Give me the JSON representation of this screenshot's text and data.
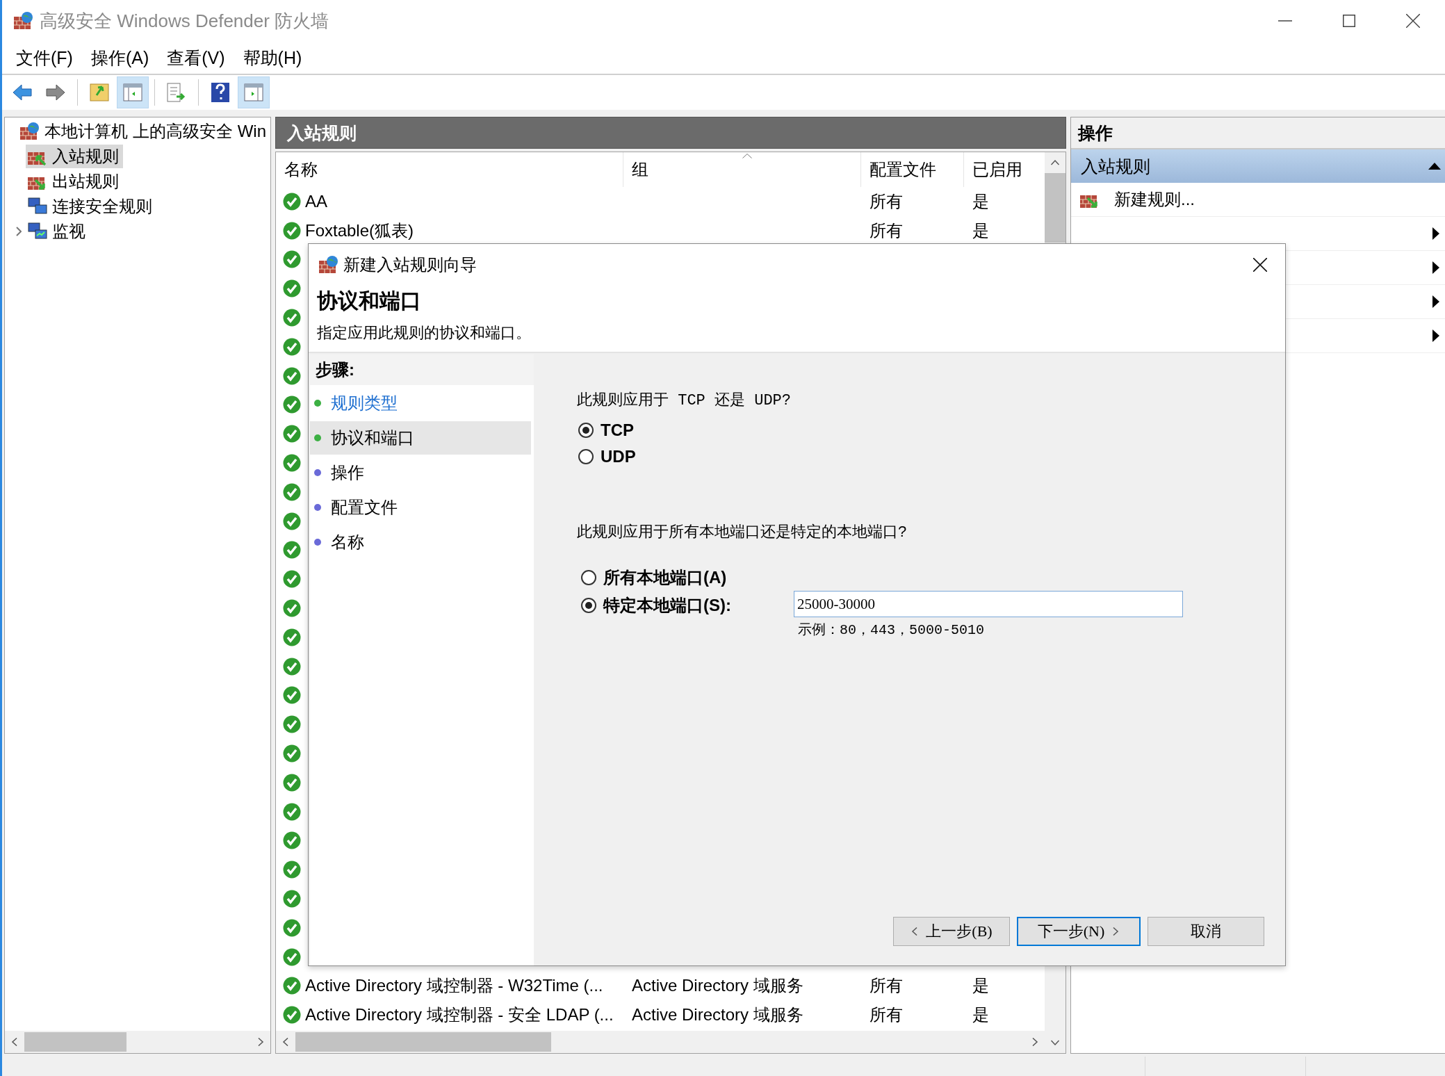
{
  "window": {
    "title": "高级安全 Windows Defender 防火墙"
  },
  "menu": [
    "文件(F)",
    "操作(A)",
    "查看(V)",
    "帮助(H)"
  ],
  "toolbar": [
    [
      {
        "kind": "back",
        "on": false
      },
      {
        "kind": "forward",
        "on": false
      }
    ],
    [
      {
        "kind": "up",
        "on": false
      },
      {
        "kind": "tree",
        "on": true
      }
    ],
    [
      {
        "kind": "export",
        "on": false
      }
    ],
    [
      {
        "kind": "help",
        "on": false
      },
      {
        "kind": "pane",
        "on": true
      }
    ]
  ],
  "tree": {
    "items": [
      {
        "label": "本地计算机 上的高级安全 Win",
        "kind": "root",
        "selected": false,
        "children": [
          {
            "label": "入站规则",
            "kind": "inbound",
            "selected": true
          },
          {
            "label": "出站规则",
            "kind": "outbound",
            "selected": false
          },
          {
            "label": "连接安全规则",
            "kind": "connection",
            "selected": false
          },
          {
            "label": "监视",
            "kind": "monitor",
            "selected": false,
            "expanded": false
          }
        ]
      }
    ]
  },
  "rules": {
    "title": "入站规则",
    "columns": [
      {
        "label": "名称",
        "sorted": false
      },
      {
        "label": "组",
        "sorted": true
      },
      {
        "label": "配置文件",
        "sorted": false
      },
      {
        "label": "已启用",
        "sorted": false
      }
    ],
    "top_rows": [
      {
        "name": "AA",
        "profile": "所有",
        "enabled": "是"
      },
      {
        "name": "Foxtable(狐表)",
        "profile": "所有",
        "enabled": "是"
      }
    ],
    "bottom_rows": [
      {
        "name": "Active Directory 域控制器 - W32Time (...",
        "group": "Active Directory 域服务",
        "profile": "所有",
        "enabled": "是"
      },
      {
        "name": "Active Directory 域控制器 - 安全 LDAP (...",
        "group": "Active Directory 域服务",
        "profile": "所有",
        "enabled": "是"
      }
    ]
  },
  "actions": {
    "title": "操作",
    "section": {
      "label": "入站规则",
      "expanded": true
    },
    "items": [
      {
        "kind": "command",
        "label": "新建规则..."
      },
      {
        "kind": "submenu"
      },
      {
        "kind": "submenu"
      },
      {
        "kind": "submenu"
      },
      {
        "kind": "submenu"
      }
    ]
  },
  "dialog": {
    "title": "新建入站规则向导",
    "heading": "协议和端口",
    "subtitle": "指定应用此规则的协议和端口。",
    "steps_title": "步骤:",
    "steps": [
      {
        "label": "规则类型",
        "completed": true,
        "selected": false
      },
      {
        "label": "协议和端口",
        "completed": true,
        "selected": true
      },
      {
        "label": "操作",
        "completed": false,
        "selected": false
      },
      {
        "label": "配置文件",
        "completed": false,
        "selected": false
      },
      {
        "label": "名称",
        "completed": false,
        "selected": false
      }
    ],
    "protocol": {
      "question": "此规则应用于 TCP 还是 UDP?",
      "options": [
        {
          "label": "TCP",
          "selected": true
        },
        {
          "label": "UDP",
          "selected": false
        }
      ]
    },
    "ports": {
      "question": "此规则应用于所有本地端口还是特定的本地端口?",
      "options": [
        {
          "label": "所有本地端口(A)",
          "selected": false
        },
        {
          "label": "特定本地端口(S):",
          "selected": true
        }
      ],
      "value": "25000-30000",
      "hint": "示例：80，443，5000-5010"
    },
    "buttons": [
      {
        "label": "上一步(B)",
        "kind": "back",
        "focused": false
      },
      {
        "label": "下一步(N)",
        "kind": "next",
        "focused": true
      },
      {
        "label": "取消",
        "kind": "cancel",
        "focused": false
      }
    ]
  }
}
